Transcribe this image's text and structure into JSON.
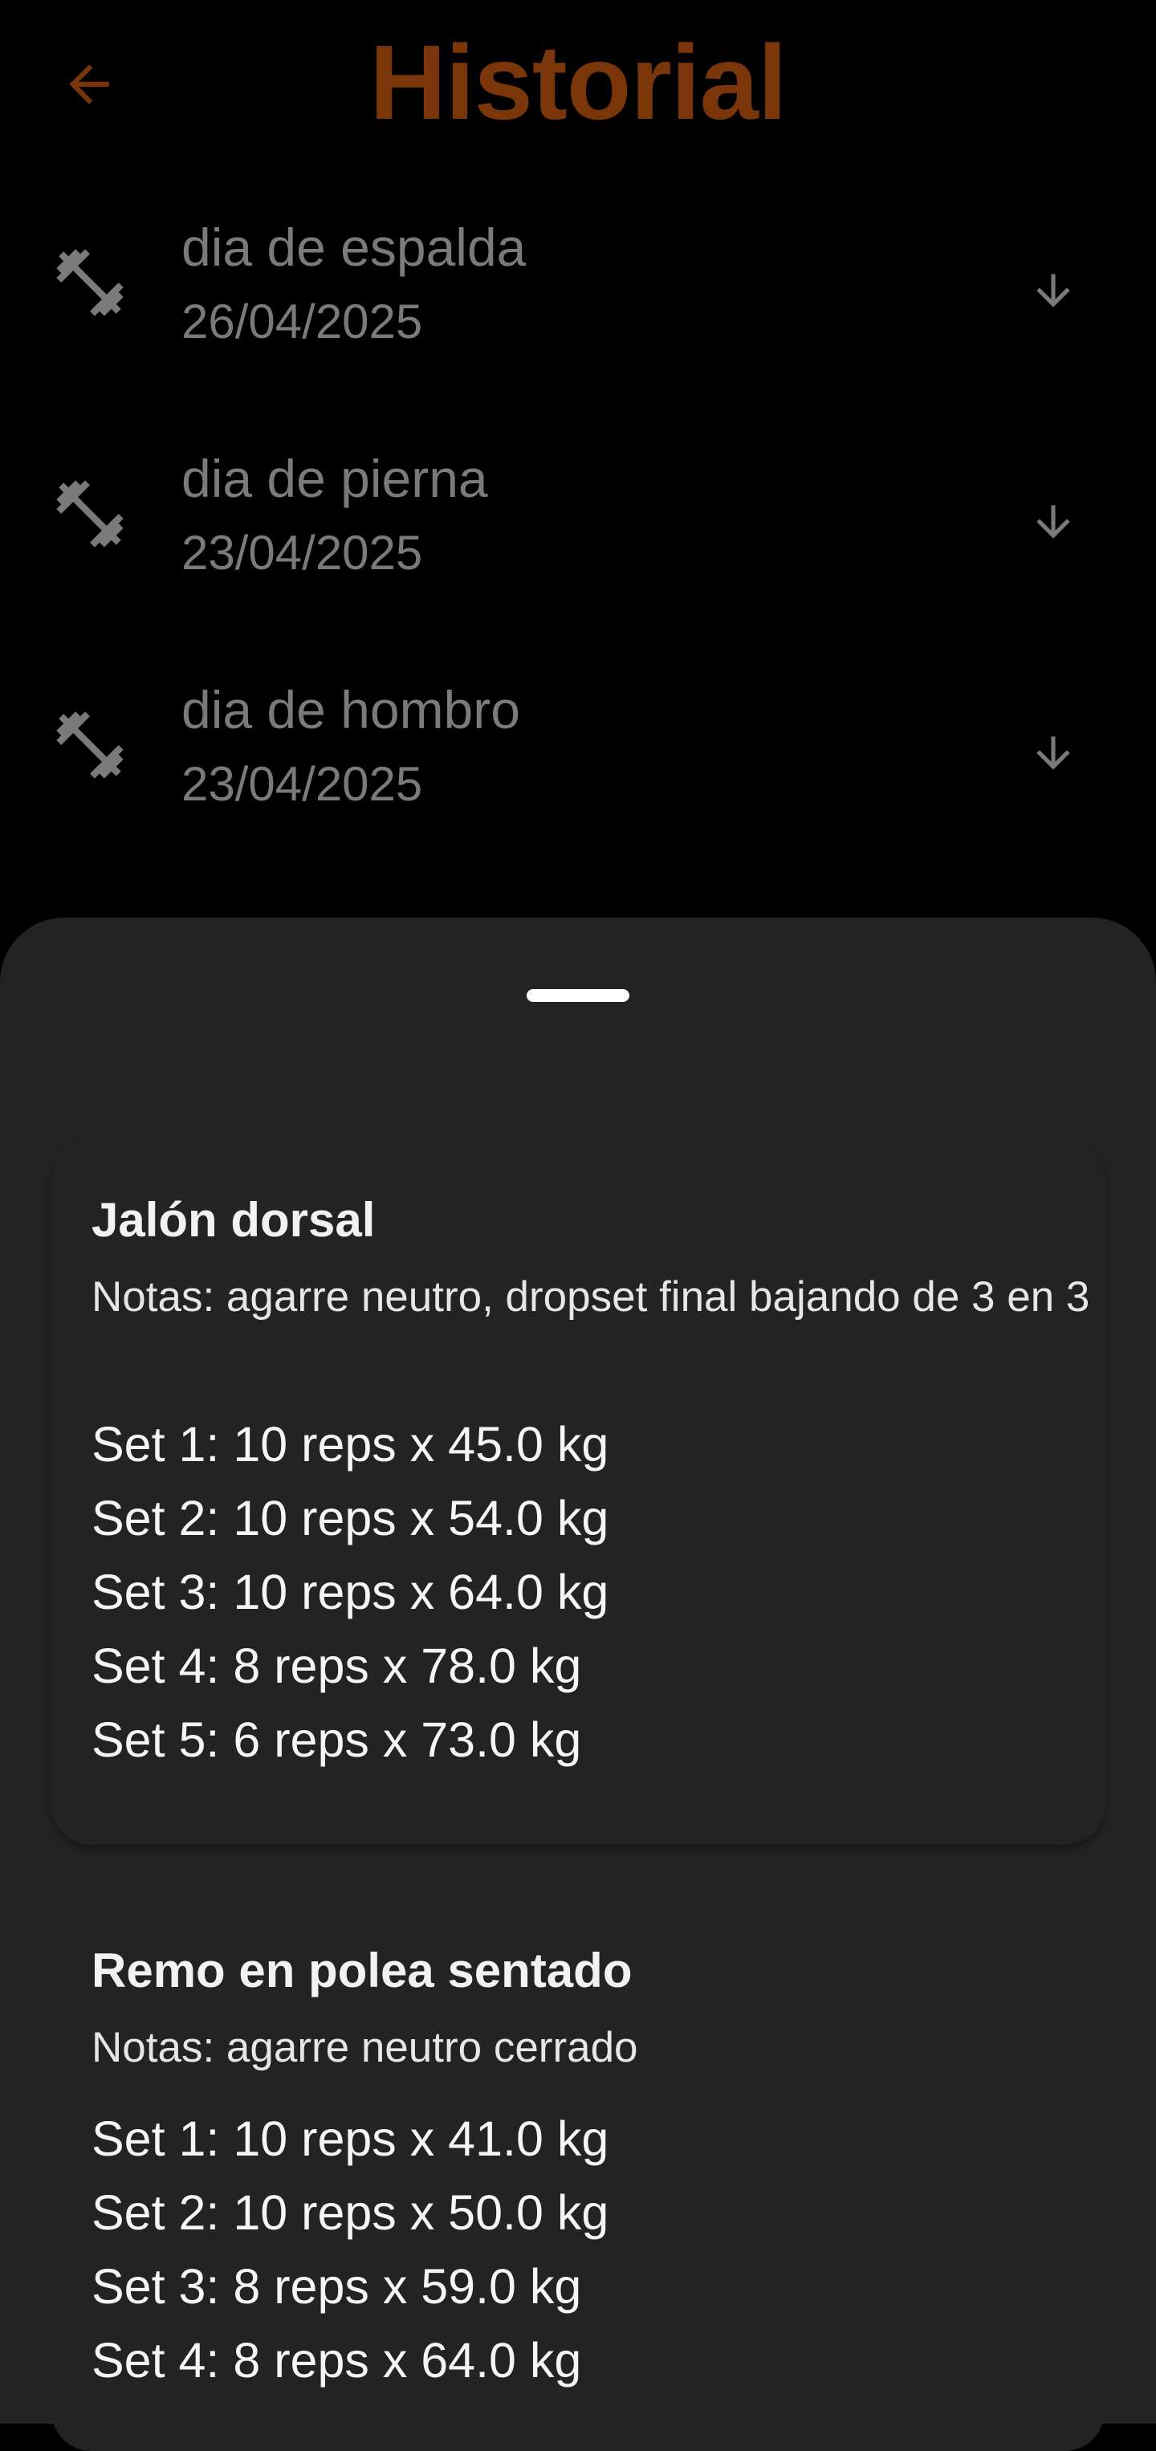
{
  "header": {
    "title": "Historial",
    "back_icon": "arrow-back-icon",
    "accent_color": "#7a3609"
  },
  "history": [
    {
      "icon": "dumbbell-icon",
      "title": "dia de espalda",
      "date": "26/04/2025",
      "action_icon": "arrow-down-icon"
    },
    {
      "icon": "dumbbell-icon",
      "title": "dia de pierna",
      "date": "23/04/2025",
      "action_icon": "arrow-down-icon"
    },
    {
      "icon": "dumbbell-icon",
      "title": "dia de hombro",
      "date": "23/04/2025",
      "action_icon": "arrow-down-icon"
    }
  ],
  "sheet": {
    "exercises": [
      {
        "name": "Jalón dorsal",
        "notes": "Notas: agarre neutro, dropset final bajando de 3 en 3",
        "sets": [
          "Set 1: 10 reps x 45.0 kg",
          "Set 2: 10 reps x 54.0 kg",
          "Set 3: 10 reps x 64.0 kg",
          "Set 4: 8 reps x 78.0 kg",
          "Set 5: 6 reps x 73.0 kg"
        ]
      },
      {
        "name": "Remo en polea sentado",
        "notes": "Notas: agarre neutro cerrado",
        "sets": [
          "Set 1: 10 reps x 41.0 kg",
          "Set 2: 10 reps x 50.0 kg",
          "Set 3: 8 reps x 59.0 kg",
          "Set 4: 8 reps x 64.0 kg"
        ]
      }
    ]
  }
}
